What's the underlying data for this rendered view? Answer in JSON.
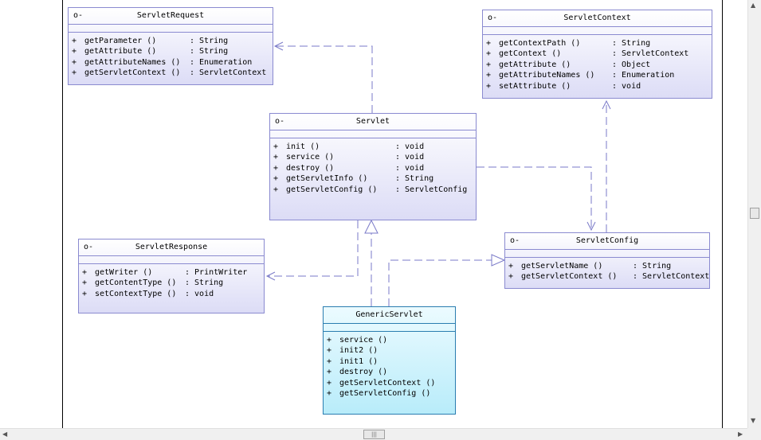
{
  "classes": {
    "servlet_request": {
      "name": "ServletRequest",
      "visibility": "o-",
      "operations": [
        {
          "sign": "+",
          "name": "getParameter ()",
          "ret": ": String"
        },
        {
          "sign": "+",
          "name": "getAttribute ()",
          "ret": ": String"
        },
        {
          "sign": "+",
          "name": "getAttributeNames ()",
          "ret": ": Enumeration"
        },
        {
          "sign": "+",
          "name": "getServletContext ()",
          "ret": ": ServletContext"
        }
      ]
    },
    "servlet_context": {
      "name": "ServletContext",
      "visibility": "o-",
      "operations": [
        {
          "sign": "+",
          "name": "getContextPath ()",
          "ret": ": String"
        },
        {
          "sign": "+",
          "name": "getContext ()",
          "ret": ": ServletContext"
        },
        {
          "sign": "+",
          "name": "getAttribute ()",
          "ret": ": Object"
        },
        {
          "sign": "+",
          "name": "getAttributeNames ()",
          "ret": ": Enumeration"
        },
        {
          "sign": "+",
          "name": "setAttribute ()",
          "ret": ": void"
        }
      ]
    },
    "servlet": {
      "name": "Servlet",
      "visibility": "o-",
      "operations": [
        {
          "sign": "+",
          "name": "init ()",
          "ret": ": void"
        },
        {
          "sign": "+",
          "name": "service ()",
          "ret": ": void"
        },
        {
          "sign": "+",
          "name": "destroy ()",
          "ret": ": void"
        },
        {
          "sign": "+",
          "name": "getServletInfo ()",
          "ret": ": String"
        },
        {
          "sign": "+",
          "name": "getServletConfig ()",
          "ret": ": ServletConfig"
        }
      ]
    },
    "servlet_response": {
      "name": "ServletResponse",
      "visibility": "o-",
      "operations": [
        {
          "sign": "+",
          "name": "getWriter ()",
          "ret": ": PrintWriter"
        },
        {
          "sign": "+",
          "name": "getContentType ()",
          "ret": ": String"
        },
        {
          "sign": "+",
          "name": "setContextType ()",
          "ret": ": void"
        }
      ]
    },
    "servlet_config": {
      "name": "ServletConfig",
      "visibility": "o-",
      "operations": [
        {
          "sign": "+",
          "name": "getServletName ()",
          "ret": ": String"
        },
        {
          "sign": "+",
          "name": "getServletContext ()",
          "ret": ": ServletContext"
        }
      ]
    },
    "generic_servlet": {
      "name": "GenericServlet",
      "visibility": "",
      "operations": [
        {
          "sign": "+",
          "name": "service ()",
          "ret": ""
        },
        {
          "sign": "+",
          "name": "init2 ()",
          "ret": ""
        },
        {
          "sign": "+",
          "name": "init1 ()",
          "ret": ""
        },
        {
          "sign": "+",
          "name": "destroy ()",
          "ret": ""
        },
        {
          "sign": "+",
          "name": "getServletContext ()",
          "ret": ""
        },
        {
          "sign": "+",
          "name": "getServletConfig ()",
          "ret": ""
        }
      ]
    }
  },
  "relationships": [
    {
      "from": "Servlet",
      "to": "ServletRequest",
      "kind": "dependency"
    },
    {
      "from": "Servlet",
      "to": "ServletResponse",
      "kind": "dependency"
    },
    {
      "from": "Servlet",
      "to": "ServletConfig",
      "kind": "dependency"
    },
    {
      "from": "ServletConfig",
      "to": "ServletContext",
      "kind": "dependency"
    },
    {
      "from": "GenericServlet",
      "to": "Servlet",
      "kind": "realization"
    },
    {
      "from": "GenericServlet",
      "to": "ServletConfig",
      "kind": "realization"
    }
  ],
  "colors": {
    "interface_border": "#8a8ad0",
    "interface_fill": "#dcdcf6",
    "class_border": "#2a7db0",
    "class_fill": "#b8ecfa",
    "connector": "#7a7ac8"
  },
  "scrollbars": {
    "thumb_grip": "|||",
    "up_arrow": "▲",
    "down_arrow": "▼",
    "left_arrow": "◀",
    "right_arrow": "▶"
  }
}
